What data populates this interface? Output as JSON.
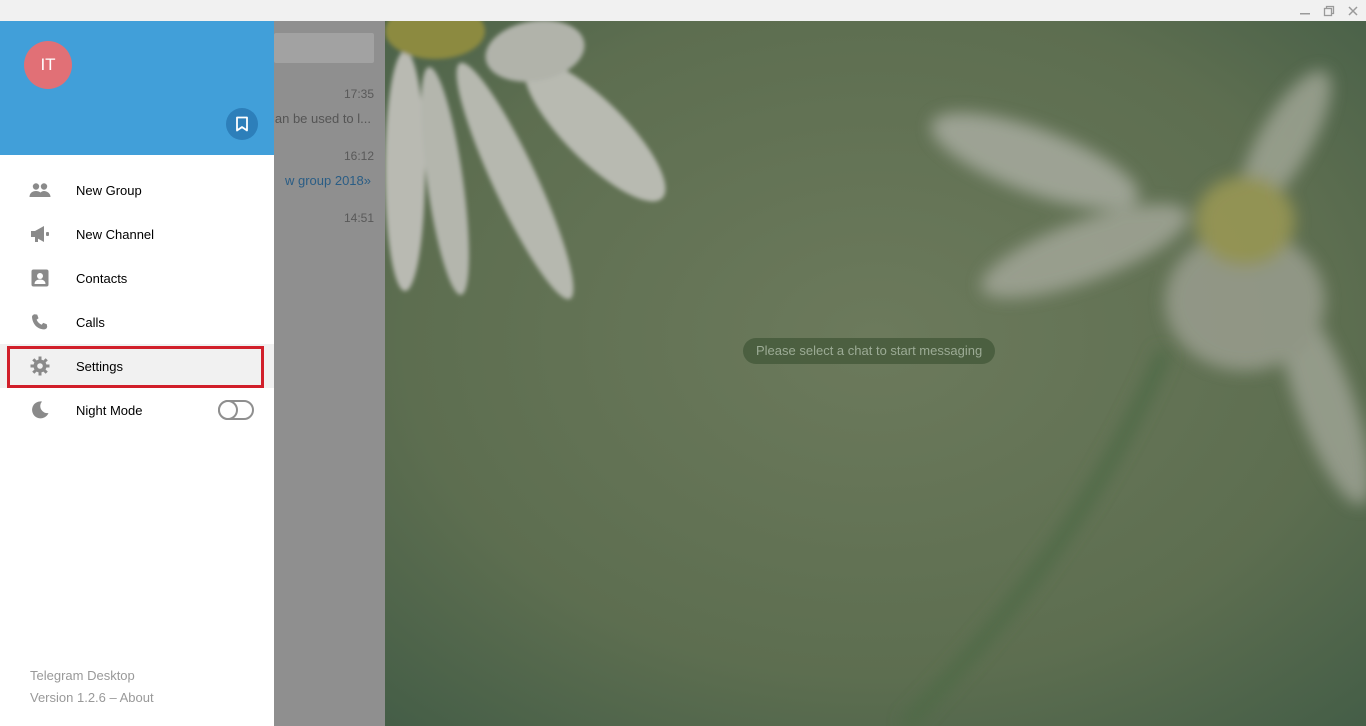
{
  "window": {
    "minimize_icon": "minimize-icon",
    "maximize_icon": "restore-icon",
    "close_icon": "close-icon"
  },
  "drawer": {
    "avatar_initials": "IT",
    "header_color": "#419fd9",
    "avatar_color": "#e17076",
    "saved_messages_icon": "bookmark-icon",
    "items": [
      {
        "label": "New Group",
        "icon": "group-icon"
      },
      {
        "label": "New Channel",
        "icon": "megaphone-icon"
      },
      {
        "label": "Contacts",
        "icon": "contact-card-icon"
      },
      {
        "label": "Calls",
        "icon": "phone-icon"
      },
      {
        "label": "Settings",
        "icon": "gear-icon",
        "highlighted": true
      },
      {
        "label": "Night Mode",
        "icon": "moon-icon",
        "toggle": false
      }
    ],
    "footer": {
      "app_name": "Telegram Desktop",
      "version": "Version 1.2.6 – About"
    },
    "highlight_color": "#d11f2a"
  },
  "chat_list": {
    "chats": [
      {
        "time": "17:35",
        "preview": "an be used to l..."
      },
      {
        "time": "16:12",
        "preview": "w group 2018»"
      },
      {
        "time": "14:51",
        "preview": ""
      }
    ]
  },
  "main": {
    "empty_state": "Please select a chat to start messaging"
  }
}
